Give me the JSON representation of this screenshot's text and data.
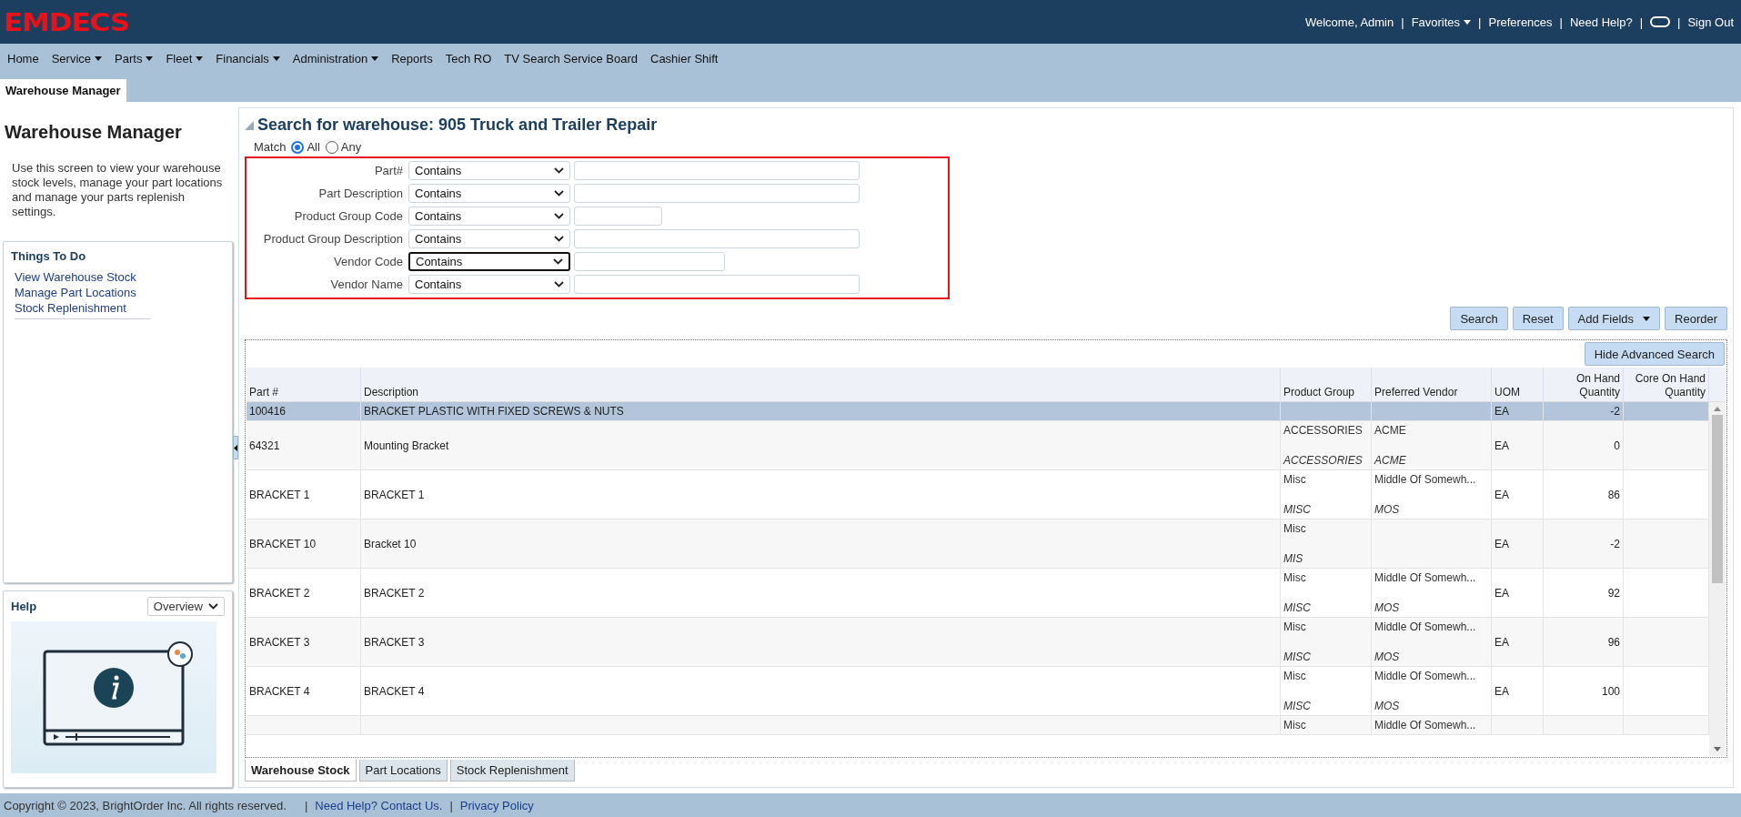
{
  "top_bar": {
    "logo": "EMDECS",
    "links": [
      {
        "kind": "text",
        "label": "Welcome, Admin"
      },
      {
        "kind": "separator",
        "label": "|"
      },
      {
        "kind": "menu",
        "label": "Favorites"
      },
      {
        "kind": "separator",
        "label": "|"
      },
      {
        "kind": "link",
        "label": "Preferences"
      },
      {
        "kind": "separator",
        "label": "|"
      },
      {
        "kind": "link",
        "label": "Need Help?"
      },
      {
        "kind": "separator",
        "label": "|"
      },
      {
        "kind": "toggle"
      },
      {
        "kind": "separator",
        "label": "|"
      },
      {
        "kind": "link",
        "label": "Sign Out"
      }
    ]
  },
  "nav": [
    {
      "label": "Home",
      "menu": false
    },
    {
      "label": "Service",
      "menu": true
    },
    {
      "label": "Parts",
      "menu": true
    },
    {
      "label": "Fleet",
      "menu": true
    },
    {
      "label": "Financials",
      "menu": true
    },
    {
      "label": "Administration",
      "menu": true
    },
    {
      "label": "Reports",
      "menu": false
    },
    {
      "label": "Tech RO",
      "menu": false
    },
    {
      "label": "TV Search Service Board",
      "menu": false
    },
    {
      "label": "Cashier Shift",
      "menu": false
    }
  ],
  "page_tabs": [
    {
      "label": "Warehouse Manager",
      "selected": true
    }
  ],
  "sidebar": {
    "title": "Warehouse Manager",
    "description": "Use this screen to view your warehouse stock levels, manage your part locations and manage your parts replenish settings.",
    "things_to_do": {
      "title": "Things To Do",
      "links": [
        "View Warehouse Stock",
        "Manage Part Locations",
        "Stock Replenishment"
      ]
    },
    "help": {
      "title": "Help",
      "select": "Overview"
    }
  },
  "search": {
    "title": "Search for warehouse: 905 Truck and Trailer Repair",
    "match_label": "Match",
    "match_options": [
      {
        "label": "All",
        "selected": true
      },
      {
        "label": "Any",
        "selected": false
      }
    ],
    "criteria": [
      {
        "label": "Part#",
        "operator": "Contains",
        "focused": false
      },
      {
        "label": "Part Description",
        "operator": "Contains",
        "focused": false
      },
      {
        "label": "Product Group Code",
        "operator": "Contains",
        "focused": false
      },
      {
        "label": "Product Group Description",
        "operator": "Contains",
        "focused": false
      },
      {
        "label": "Vendor Code",
        "operator": "Contains",
        "focused": true
      },
      {
        "label": "Vendor Name",
        "operator": "Contains",
        "focused": false
      }
    ],
    "buttons": [
      {
        "label": "Search",
        "kind": "plain"
      },
      {
        "label": "Reset",
        "kind": "plain"
      },
      {
        "label": "Add Fields",
        "kind": "split"
      },
      {
        "label": "Reorder",
        "kind": "plain"
      }
    ]
  },
  "table": {
    "toolbar_button": "Hide Advanced Search",
    "columns": [
      "Part #",
      "Description",
      "Product Group",
      "Preferred Vendor",
      "UOM",
      "On Hand Quantity",
      "Core On Hand Quantity"
    ],
    "rows": [
      {
        "selected": true,
        "part": "100416",
        "description": "BRACKET PLASTIC WITH FIXED SCREWS & NUTS",
        "uom": "EA",
        "on_hand": "-2"
      },
      {
        "selected": false,
        "part": "64321",
        "description": "Mounting Bracket",
        "group": "ACCESSORIES",
        "group_code": "ACCESSORIES",
        "vendor": "ACME",
        "vendor_code": "ACME",
        "uom": "EA",
        "on_hand": "0"
      },
      {
        "selected": false,
        "part": "BRACKET 1",
        "description": "BRACKET 1",
        "group": "Misc",
        "group_code": "MISC",
        "vendor": "Middle Of Somewh...",
        "vendor_code": "MOS",
        "uom": "EA",
        "on_hand": "86"
      },
      {
        "selected": false,
        "part": "BRACKET 10",
        "description": "Bracket 10",
        "group": "Misc",
        "group_code": "MIS",
        "uom": "EA",
        "on_hand": "-2"
      },
      {
        "selected": false,
        "part": "BRACKET 2",
        "description": "BRACKET 2",
        "group": "Misc",
        "group_code": "MISC",
        "vendor": "Middle Of Somewh...",
        "vendor_code": "MOS",
        "uom": "EA",
        "on_hand": "92"
      },
      {
        "selected": false,
        "part": "BRACKET 3",
        "description": "BRACKET 3",
        "group": "Misc",
        "group_code": "MISC",
        "vendor": "Middle Of Somewh...",
        "vendor_code": "MOS",
        "uom": "EA",
        "on_hand": "96"
      },
      {
        "selected": false,
        "part": "BRACKET 4",
        "description": "BRACKET 4",
        "group": "Misc",
        "group_code": "MISC",
        "vendor": "Middle Of Somewh...",
        "vendor_code": "MOS",
        "uom": "EA",
        "on_hand": "100"
      },
      {
        "selected": false,
        "group": "Misc",
        "vendor": "Middle Of Somewh..."
      }
    ]
  },
  "bottom_tabs": [
    {
      "label": "Warehouse Stock",
      "selected": true
    },
    {
      "label": "Part Locations",
      "selected": false
    },
    {
      "label": "Stock Replenishment",
      "selected": false
    }
  ],
  "footer": {
    "copyright": "Copyright © 2023, BrightOrder Inc. All rights reserved.",
    "links": [
      "Need Help? Contact Us.",
      "Privacy Policy"
    ],
    "separator": "|"
  }
}
